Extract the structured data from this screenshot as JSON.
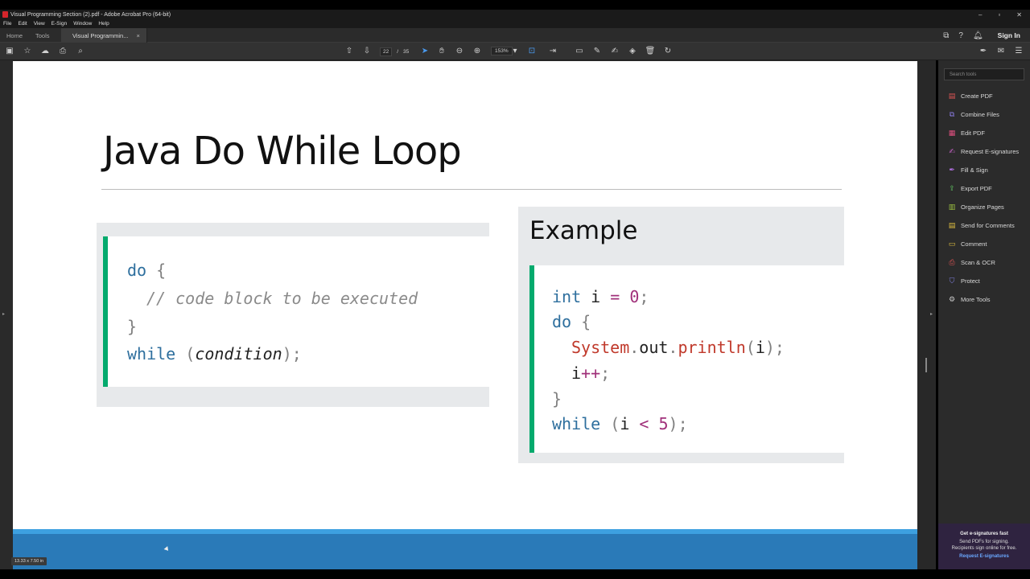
{
  "window": {
    "title": "Visual Programming Section (2).pdf - Adobe Acrobat Pro (64-bit)",
    "minimize": "–",
    "restore": "▫",
    "close": "✕"
  },
  "menu": [
    "File",
    "Edit",
    "View",
    "E-Sign",
    "Window",
    "Help"
  ],
  "tabs": {
    "home": "Home",
    "tools": "Tools",
    "document": "Visual Programmin...",
    "close": "×"
  },
  "header_right": {
    "sign_in": "Sign In"
  },
  "toolbar": {
    "current_page": "22",
    "separator": "/",
    "total_pages": "35",
    "zoom": "153%"
  },
  "slide": {
    "title": "Java Do While Loop",
    "syntax": {
      "line1_kw": "do",
      "line1_brace": "{",
      "line2_comment": "// code block to be executed",
      "line3_brace": "}",
      "line4_kw": "while",
      "line4_open": "(",
      "line4_cond": "condition",
      "line4_close": ");"
    },
    "example": {
      "heading": "Example",
      "l1_type": "int",
      "l1_var": "i",
      "l1_eq": "=",
      "l1_num": "0",
      "l1_end": ";",
      "l2_kw": "do",
      "l2_brace": "{",
      "l3_cls": "System",
      "l3_dot1": ".",
      "l3_out": "out",
      "l3_dot2": ".",
      "l3_method": "println",
      "l3_open": "(",
      "l3_var": "i",
      "l3_close": ");",
      "l4_var": "i",
      "l4_op": "++",
      "l4_end": ";",
      "l5_brace": "}",
      "l6_kw": "while",
      "l6_open": "(",
      "l6_var": "i",
      "l6_op": "<",
      "l6_num": "5",
      "l6_close": ");"
    }
  },
  "page_size_badge": "13.33 x 7.50 in",
  "tools_pane": {
    "search_placeholder": "Search tools",
    "items": [
      {
        "label": "Create PDF",
        "color": "#e05555"
      },
      {
        "label": "Combine Files",
        "color": "#8a7be0"
      },
      {
        "label": "Edit PDF",
        "color": "#e05080"
      },
      {
        "label": "Request E-signatures",
        "color": "#c060c0"
      },
      {
        "label": "Fill & Sign",
        "color": "#b070e0"
      },
      {
        "label": "Export PDF",
        "color": "#5fc060"
      },
      {
        "label": "Organize Pages",
        "color": "#9bc040"
      },
      {
        "label": "Send for Comments",
        "color": "#e0c040"
      },
      {
        "label": "Comment",
        "color": "#e0c040"
      },
      {
        "label": "Scan & OCR",
        "color": "#e05555"
      },
      {
        "label": "Protect",
        "color": "#8080e0"
      },
      {
        "label": "More Tools",
        "color": "#cccccc"
      }
    ]
  },
  "promo": {
    "title": "Get e-signatures fast",
    "line1": "Send PDFs for signing.",
    "line2": "Recipients sign online for free.",
    "link": "Request E-signatures"
  }
}
